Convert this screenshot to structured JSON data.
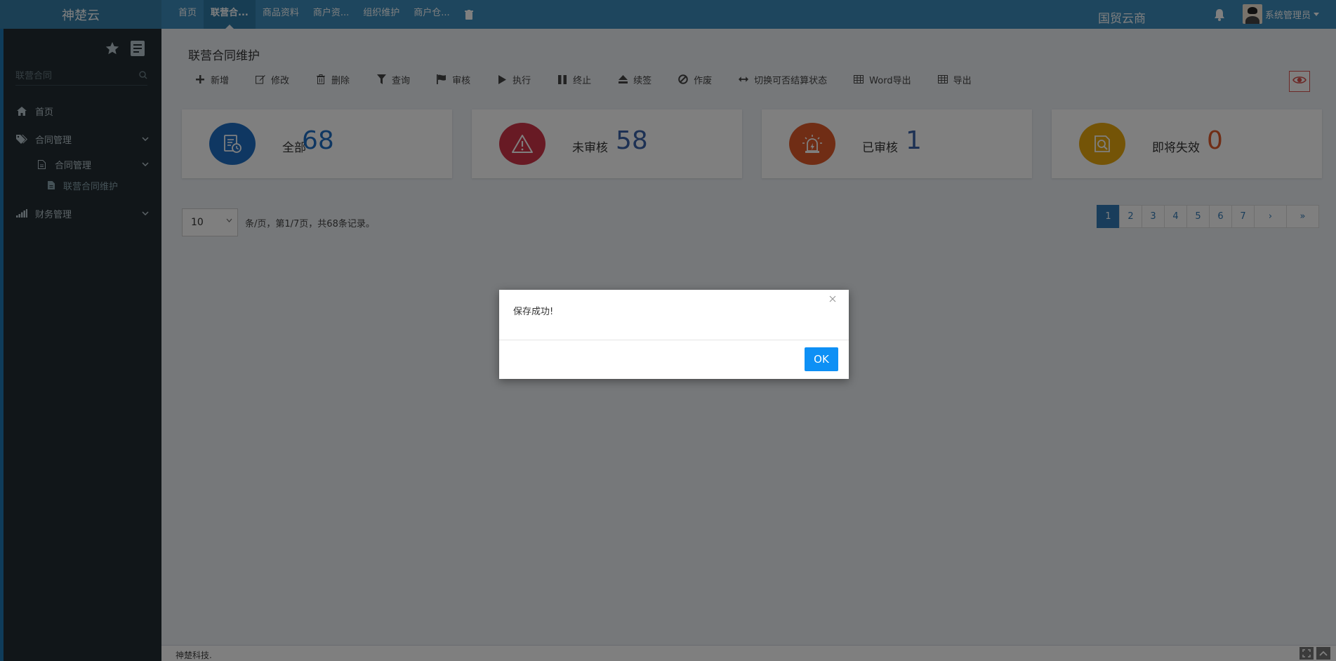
{
  "app": {
    "brand": "神楚云",
    "org_name": "国贸云商",
    "user_name": "系统管理员"
  },
  "topnav": {
    "items": [
      {
        "label": "首页"
      },
      {
        "label": "联营合..."
      },
      {
        "label": "商品资料"
      },
      {
        "label": "商户资..."
      },
      {
        "label": "组织维护"
      },
      {
        "label": "商户仓..."
      }
    ]
  },
  "sidebar": {
    "search_placeholder": "联营合同",
    "items": [
      {
        "label": "首页"
      },
      {
        "label": "合同管理"
      },
      {
        "label": "合同管理"
      },
      {
        "label": "联营合同维护"
      },
      {
        "label": "财务管理"
      }
    ]
  },
  "page": {
    "title": "联营合同维护"
  },
  "toolbar": {
    "buttons": [
      {
        "label": "新增",
        "icon": "plus-icon"
      },
      {
        "label": "修改",
        "icon": "edit-icon"
      },
      {
        "label": "删除",
        "icon": "trash-icon"
      },
      {
        "label": "查询",
        "icon": "filter-icon"
      },
      {
        "label": "审核",
        "icon": "flag-icon"
      },
      {
        "label": "执行",
        "icon": "play-icon"
      },
      {
        "label": "终止",
        "icon": "pause-icon"
      },
      {
        "label": "续签",
        "icon": "eject-icon"
      },
      {
        "label": "作废",
        "icon": "ban-icon"
      },
      {
        "label": "切换可否结算状态",
        "icon": "arrows-h-icon"
      },
      {
        "label": "Word导出",
        "icon": "table-icon"
      },
      {
        "label": "导出",
        "icon": "table-icon"
      }
    ]
  },
  "cards": [
    {
      "label": "全部",
      "count": "68",
      "color": "#1f6fc5",
      "count_color": "#1f6fc5",
      "icon": "document-clock-icon"
    },
    {
      "label": "未审核",
      "count": "58",
      "color": "#d03548",
      "count_color": "#3a63a8",
      "icon": "warning-icon"
    },
    {
      "label": "已审核",
      "count": "1",
      "color": "#e05a2b",
      "count_color": "#3a63a8",
      "icon": "alarm-light-icon"
    },
    {
      "label": "即将失效",
      "count": "0",
      "color": "#e8a90f",
      "count_color": "#e05a2b",
      "icon": "search-doc-icon"
    }
  ],
  "pager": {
    "page_size": "10",
    "info": "条/页，第1/7页，共68条记录。",
    "pages": [
      "1",
      "2",
      "3",
      "4",
      "5",
      "6",
      "7"
    ],
    "next": "›",
    "last": "»",
    "active_page": "1"
  },
  "footer": {
    "text": "神楚科技."
  },
  "modal": {
    "message": "保存成功!",
    "ok_label": "OK",
    "close_label": "×"
  },
  "colors": {
    "topbar": "#3c8dbc",
    "sidebar": "#222d32",
    "ok_button": "#0e90f5"
  }
}
